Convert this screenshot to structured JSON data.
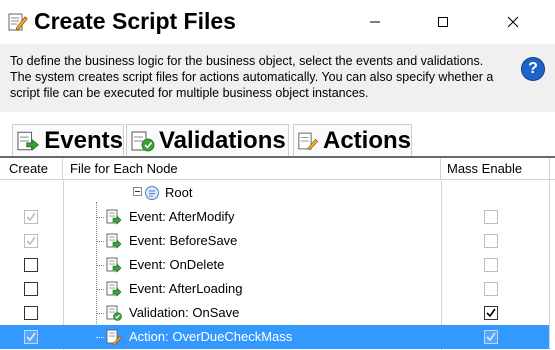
{
  "window": {
    "title": "Create Script Files"
  },
  "description": {
    "text": "To define the business logic for the business object, select the events and validations. The system creates script files for actions automatically. You can also specify whether a script file can be executed for multiple business object instances."
  },
  "help": {
    "glyph": "?"
  },
  "tabs": [
    {
      "label": "Events",
      "icon": "event-script-icon"
    },
    {
      "label": "Validations",
      "icon": "validation-script-icon"
    },
    {
      "label": "Actions",
      "icon": "action-script-icon"
    }
  ],
  "grid": {
    "columns": [
      "Create",
      "File for Each Node",
      "Mass Enable"
    ],
    "root": {
      "label": "Root",
      "expander": "collapse",
      "icon": "node-icon"
    },
    "rows": [
      {
        "label": "Event: AfterModify",
        "create_checked": true,
        "create_enabled": false,
        "mass_checked": false,
        "mass_enabled": false,
        "icon": "event-file-icon",
        "selected": false
      },
      {
        "label": "Event: BeforeSave",
        "create_checked": true,
        "create_enabled": false,
        "mass_checked": false,
        "mass_enabled": false,
        "icon": "event-file-icon",
        "selected": false
      },
      {
        "label": "Event: OnDelete",
        "create_checked": false,
        "create_enabled": true,
        "mass_checked": false,
        "mass_enabled": false,
        "icon": "event-file-icon",
        "selected": false
      },
      {
        "label": "Event: AfterLoading",
        "create_checked": false,
        "create_enabled": true,
        "mass_checked": false,
        "mass_enabled": false,
        "icon": "event-file-icon",
        "selected": false
      },
      {
        "label": "Validation: OnSave",
        "create_checked": false,
        "create_enabled": true,
        "mass_checked": true,
        "mass_enabled": true,
        "icon": "validation-file-icon",
        "selected": false
      },
      {
        "label": "Action: OverDueCheckMass",
        "create_checked": true,
        "create_enabled": false,
        "mass_checked": true,
        "mass_enabled": false,
        "icon": "action-file-icon",
        "selected": true
      }
    ]
  },
  "colors": {
    "selection": "#3399ff",
    "help_blue": "#1e63c8",
    "description_bg": "#f0f0f0"
  }
}
